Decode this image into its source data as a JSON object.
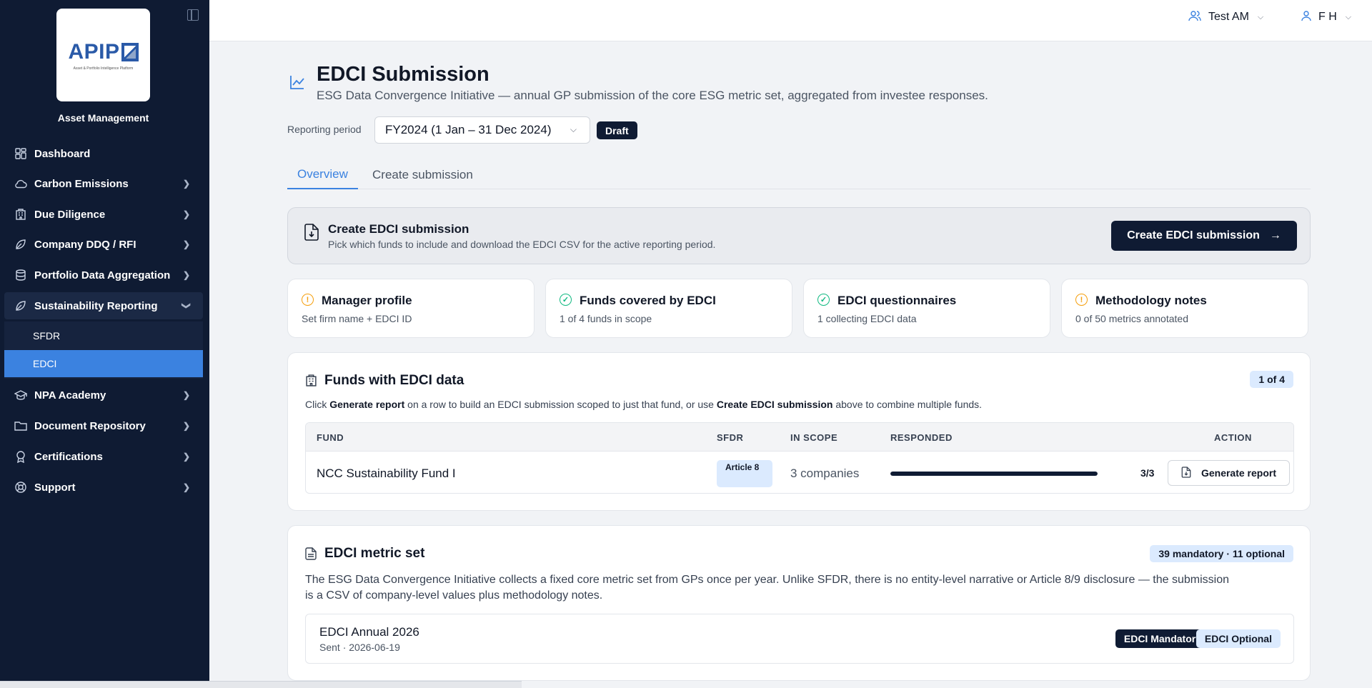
{
  "sidebar": {
    "logo_text": "APIP",
    "logo_tagline": "Asset & Portfolio Intelligence Platform",
    "org_name": "Asset Management",
    "items": [
      {
        "label": "Dashboard",
        "icon": "grid-icon"
      },
      {
        "label": "Carbon Emissions",
        "icon": "cloud-icon"
      },
      {
        "label": "Due Diligence",
        "icon": "building-icon"
      },
      {
        "label": "Company DDQ / RFI",
        "icon": "leaf-icon"
      },
      {
        "label": "Portfolio Data Aggregation",
        "icon": "database-icon"
      },
      {
        "label": "Sustainability Reporting",
        "icon": "leaf-icon"
      },
      {
        "label": "NPA Academy",
        "icon": "graduation-cap-icon"
      },
      {
        "label": "Document Repository",
        "icon": "folder-icon"
      },
      {
        "label": "Certifications",
        "icon": "award-icon"
      },
      {
        "label": "Support",
        "icon": "lifebuoy-icon"
      }
    ],
    "sub_items": [
      {
        "label": "SFDR"
      },
      {
        "label": "EDCI"
      }
    ]
  },
  "topbar": {
    "account_label": "Test AM",
    "user_label": "F H"
  },
  "header": {
    "title": "EDCI Submission",
    "subtitle": "ESG Data Convergence Initiative — annual GP submission of the core ESG metric set, aggregated from investee responses.",
    "period_label": "Reporting period",
    "period_value": "FY2024 (1 Jan – 31 Dec 2024)",
    "status_badge": "Draft"
  },
  "tabs": [
    {
      "label": "Overview",
      "active": true
    },
    {
      "label": "Create submission",
      "active": false
    }
  ],
  "create_card": {
    "title": "Create EDCI submission",
    "subtitle": "Pick which funds to include and download the EDCI CSV for the active reporting period.",
    "button_label": "Create EDCI submission"
  },
  "stats": [
    {
      "title": "Manager profile",
      "subtitle": "Set firm name + EDCI ID",
      "status": "warning"
    },
    {
      "title": "Funds covered by EDCI",
      "subtitle": "1 of 4 funds in scope",
      "status": "ok"
    },
    {
      "title": "EDCI questionnaires",
      "subtitle": "1 collecting EDCI data",
      "status": "ok"
    },
    {
      "title": "Methodology notes",
      "subtitle": "0 of 50 metrics annotated",
      "status": "warning"
    }
  ],
  "funds": {
    "title": "Funds with EDCI data",
    "count_badge": "1 of 4",
    "desc_prefix": "Click ",
    "desc_generate": "Generate report",
    "desc_middle": " on a row to build an EDCI submission scoped to just that fund, or use ",
    "desc_create": "Create EDCI submission",
    "desc_suffix": " above to combine multiple funds.",
    "columns": {
      "fund": "FUND",
      "sfdr": "SFDR",
      "in_scope": "IN SCOPE",
      "responded": "RESPONDED",
      "action": "ACTION"
    },
    "rows": [
      {
        "fund": "NCC Sustainability Fund I",
        "sfdr": "Article 8",
        "in_scope": "3 companies",
        "responded": "3/3",
        "responded_fraction": 1.0,
        "action": "Generate report"
      }
    ]
  },
  "metric_set": {
    "title": "EDCI metric set",
    "badge": "39 mandatory · 11 optional",
    "description": "The ESG Data Convergence Initiative collects a fixed core metric set from GPs once per year. Unlike SFDR, there is no entity-level narrative or Article 8/9 disclosure — the submission is a CSV of company-level values plus methodology notes.",
    "questionnaire": {
      "title": "EDCI Annual 2026",
      "subtitle": "Sent · 2026-06-19",
      "tag_mandatory": "EDCI Mandatory",
      "tag_optional": "EDCI Optional"
    }
  },
  "colors": {
    "sidebar_bg": "#0f1b33",
    "accent": "#3b82e0",
    "warning": "#f59e0b",
    "ok": "#10b981"
  }
}
